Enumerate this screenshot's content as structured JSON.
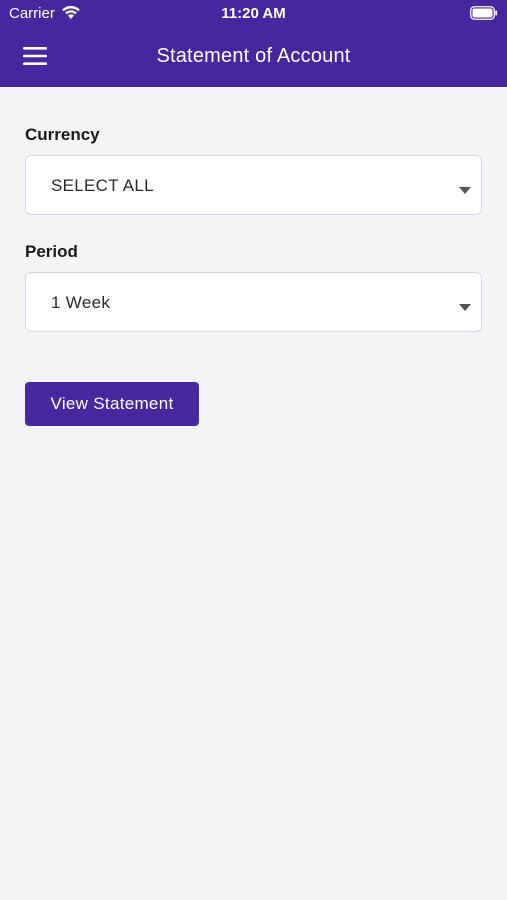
{
  "status_bar": {
    "carrier": "Carrier",
    "time": "11:20 AM",
    "icons": [
      "wifi-icon",
      "battery-icon"
    ]
  },
  "header": {
    "title": "Statement of Account",
    "menu_icon": "hamburger-menu-icon",
    "background": "#4527a0"
  },
  "form": {
    "currency": {
      "label": "Currency",
      "value": "SELECT ALL"
    },
    "period": {
      "label": "Period",
      "value": "1 Week"
    },
    "submit_label": "View Statement"
  },
  "colors": {
    "accent": "#4527a0",
    "background": "#f4f4f4",
    "field_border": "#d8d4ec"
  }
}
